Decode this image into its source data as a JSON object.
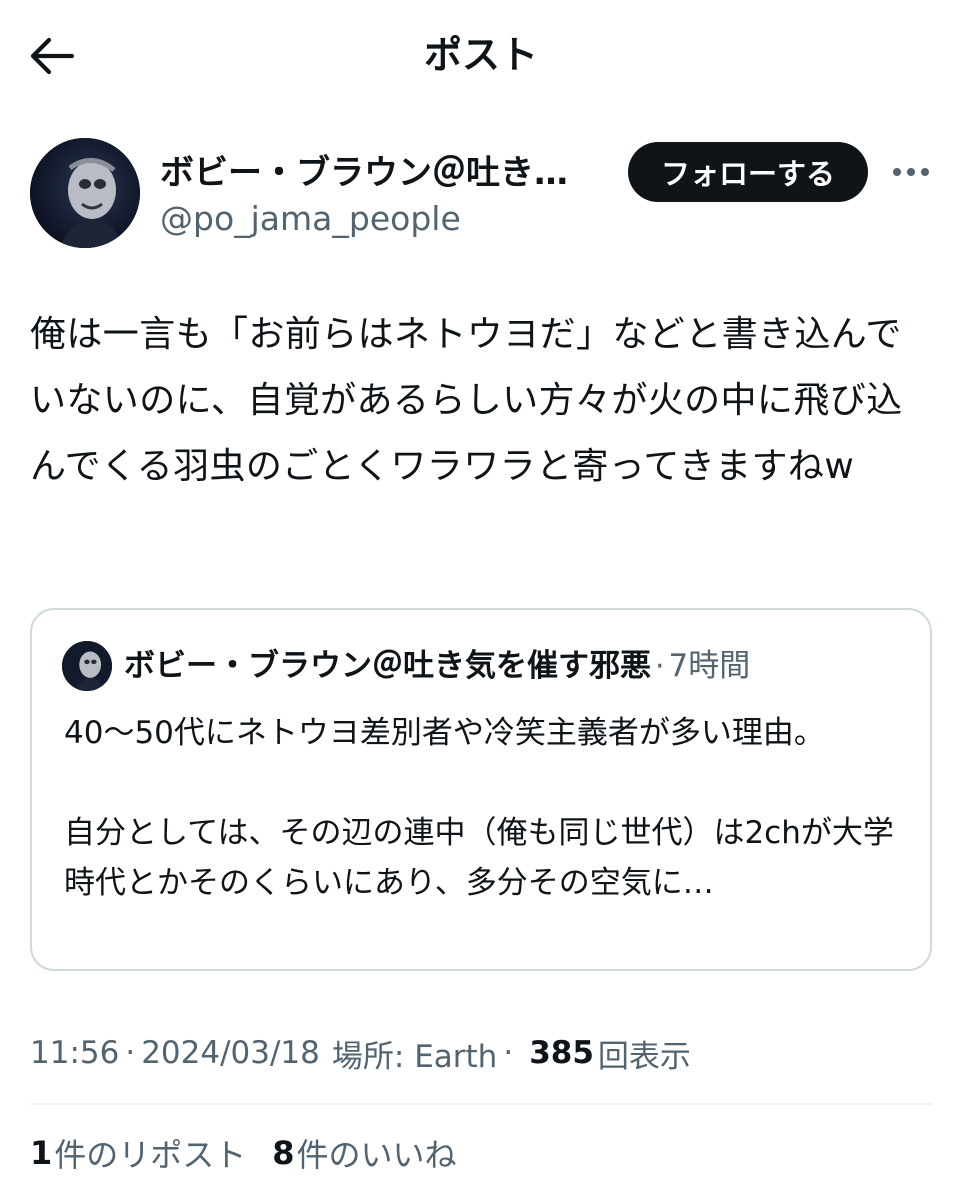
{
  "header": {
    "title": "ポスト",
    "back_icon": "arrow-left-icon"
  },
  "author": {
    "name": "ボビー・ブラウン＠吐き…",
    "handle": "@po_jama_people",
    "follow_label": "フォローする",
    "more_icon": "more-horizontal-icon"
  },
  "post": {
    "text": "俺は一言も「お前らはネトウヨだ」などと書き込んでいないのに、自覚があるらしい方々が火の中に飛び込んでくる羽虫のごとくワラワラと寄ってきますねw"
  },
  "quote": {
    "name": "ボビー・ブラウン＠吐き気を催す邪悪",
    "separator": "·",
    "time": "7時間",
    "text": "40〜50代にネトウヨ差別者や冷笑主義者が多い理由。\n\n自分としては、その辺の連中（俺も同じ世代）は2chが大学時代とかそのくらいにあり、多分その空気に…"
  },
  "meta": {
    "time": "11:56",
    "sep": "·",
    "date": "2024/03/18",
    "location_label": "場所: Earth",
    "views_count": "385",
    "views_label": "回表示"
  },
  "stats": {
    "reposts_count": "1",
    "reposts_label": "件のリポスト",
    "likes_count": "8",
    "likes_label": "件のいいね"
  },
  "colors": {
    "text": "#0f1419",
    "secondary": "#536471",
    "border": "#cfd9de",
    "button_bg": "#0f1419"
  }
}
